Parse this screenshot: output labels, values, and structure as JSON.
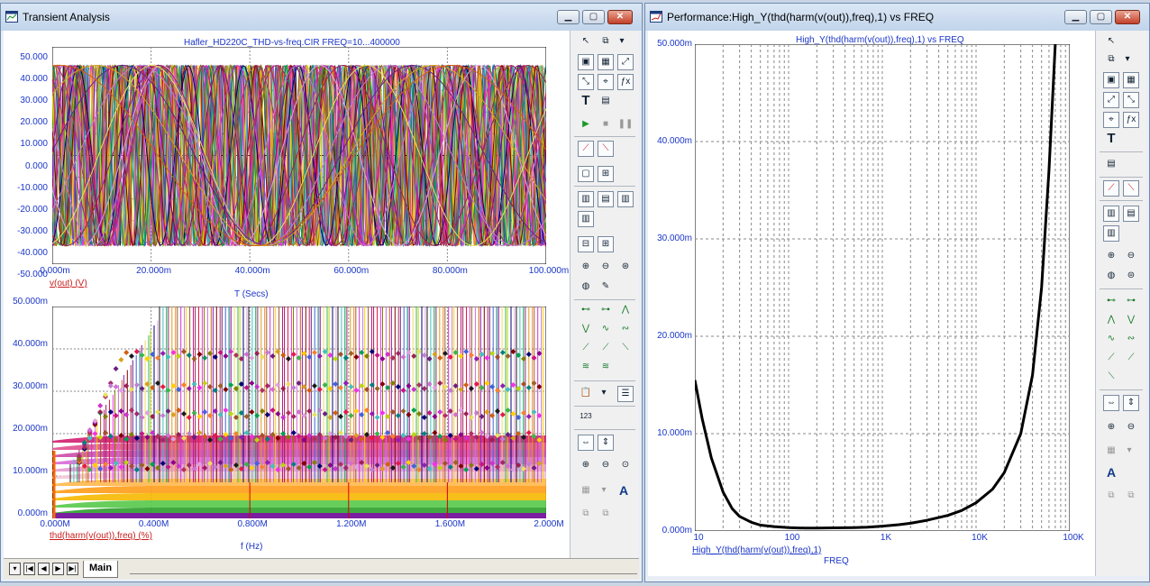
{
  "left_window": {
    "title": "Transient Analysis",
    "top_plot": {
      "title": "Hafler_HD220C_THD-vs-freq.CIR FREQ=10...400000",
      "y_ticks": [
        "50.000",
        "40.000",
        "30.000",
        "20.000",
        "10.000",
        "0.000",
        "-10.000",
        "-20.000",
        "-30.000",
        "-40.000",
        "-50.000"
      ],
      "x_ticks": [
        "0.000m",
        "20.000m",
        "40.000m",
        "60.000m",
        "80.000m",
        "100.000m"
      ],
      "trace_label": "v(out) (V)",
      "x_axis_label": "T (Secs)"
    },
    "bottom_plot": {
      "y_ticks": [
        "50.000m",
        "40.000m",
        "30.000m",
        "20.000m",
        "10.000m",
        "0.000m"
      ],
      "x_ticks": [
        "0.000M",
        "0.400M",
        "0.800M",
        "1.200M",
        "1.600M",
        "2.000M"
      ],
      "trace_label": "thd(harm(v(out)),freq) (%)",
      "x_axis_label": "f (Hz)"
    },
    "tab_label": "Main"
  },
  "right_window": {
    "title": "Performance:High_Y(thd(harm(v(out)),freq),1) vs FREQ",
    "plot": {
      "title": "High_Y(thd(harm(v(out)),freq),1) vs FREQ",
      "y_ticks": [
        "50.000m",
        "40.000m",
        "30.000m",
        "20.000m",
        "10.000m",
        "0.000m"
      ],
      "x_ticks": [
        "10",
        "100",
        "1K",
        "10K",
        "100K"
      ],
      "trace_label": "High_Y(thd(harm(v(out)),freq),1)",
      "x_axis_label": "FREQ"
    }
  },
  "chart_data": [
    {
      "type": "line",
      "title": "Hafler_HD220C_THD-vs-freq.CIR FREQ=10...400000",
      "xlabel": "T (Secs)",
      "ylabel": "v(out) (V)",
      "xlim": [
        0,
        100
      ],
      "ylim": [
        -50,
        50
      ],
      "amplitude": 41.5,
      "series_count": 30,
      "grid": true
    },
    {
      "type": "scatter",
      "title": "",
      "xlabel": "f (Hz)",
      "ylabel": "thd(harm(v(out)),freq) (%)",
      "xlim": [
        0,
        2
      ],
      "ylim": [
        0,
        50
      ],
      "grid": true
    },
    {
      "type": "line",
      "title": "High_Y(thd(harm(v(out)),freq),1) vs FREQ",
      "xlabel": "FREQ",
      "ylabel": "High_Y(thd(harm(v(out)),freq),1)",
      "x_scale": "log",
      "xlim": [
        10,
        100000
      ],
      "ylim": [
        0,
        50
      ],
      "x": [
        10,
        12,
        15,
        20,
        25,
        30,
        40,
        50,
        70,
        100,
        150,
        200,
        300,
        500,
        700,
        1000,
        1500,
        2000,
        3000,
        5000,
        7000,
        10000,
        15000,
        20000,
        30000,
        40000,
        50000,
        60000,
        70000
      ],
      "y": [
        15.5,
        11.5,
        7.5,
        4.0,
        2.3,
        1.5,
        0.9,
        0.6,
        0.45,
        0.35,
        0.3,
        0.3,
        0.32,
        0.35,
        0.4,
        0.5,
        0.65,
        0.8,
        1.1,
        1.6,
        2.1,
        2.9,
        4.3,
        6.0,
        10.0,
        16.0,
        25.0,
        37.0,
        50.0
      ],
      "grid": true
    }
  ]
}
